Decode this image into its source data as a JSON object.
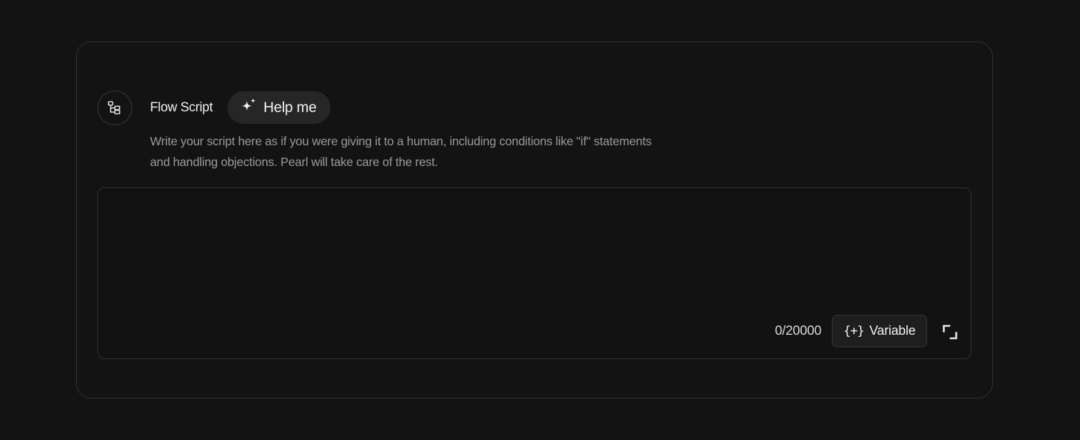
{
  "section": {
    "title": "Flow Script",
    "help_button_label": "Help me",
    "description": "Write your script here as if you were giving it to a human, including conditions like \"if\" statements and handling objections. Pearl will take care of the rest."
  },
  "editor": {
    "value": "",
    "placeholder": "",
    "char_count": "0/20000",
    "variable_button_glyph": "{+}",
    "variable_button_label": "Variable"
  },
  "icons": {
    "section_icon": "flow-tree-icon",
    "help_icon": "sparkle-icon",
    "expand_icon": "expand-icon"
  },
  "colors": {
    "background": "#131313",
    "border": "#343434",
    "pill": "#262626",
    "text_primary": "#f0f0f0",
    "text_muted": "#9a9a9a"
  }
}
